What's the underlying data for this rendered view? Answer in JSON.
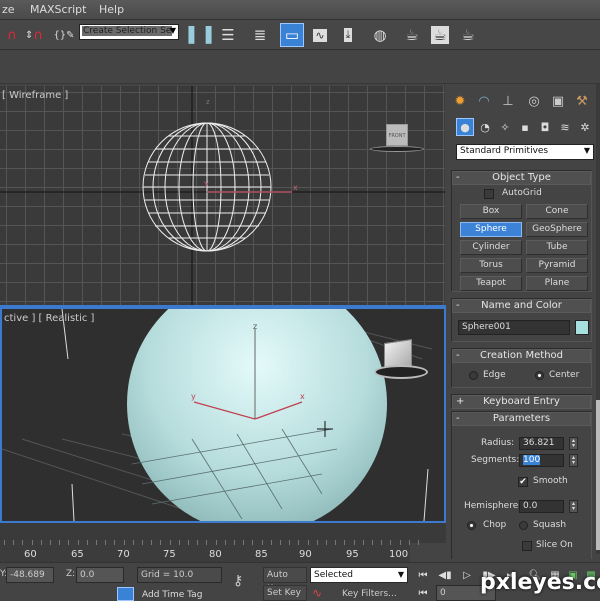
{
  "menubar": {
    "items": [
      "ze",
      "MAXScript",
      "Help"
    ]
  },
  "toolbar": {
    "selection_set": {
      "value": "Create Selection Se",
      "placeholder": "Create Selection Set"
    },
    "icons": [
      "percent-snap-icon",
      "spinner-snap-icon",
      "edit-named-selection-icon",
      "mirror-icon",
      "align-icon",
      "layer-manager-icon",
      "graphite-ribbon-icon",
      "curve-editor-icon",
      "schematic-view-icon",
      "material-editor-icon",
      "render-setup-icon",
      "rendered-frame-icon",
      "render-icon"
    ]
  },
  "viewports": {
    "top": {
      "label": "[ Wireframe ]",
      "axis_x": "x",
      "axis_y": "y",
      "axis_z": "z",
      "viewcube_label": "FRONT"
    },
    "perspective": {
      "label": "ctive ] [ Realistic ]",
      "axis_x": "x",
      "axis_y": "y",
      "axis_z": "z"
    }
  },
  "command_panel": {
    "tabs": [
      "create",
      "modify",
      "hierarchy",
      "motion",
      "display",
      "utilities"
    ],
    "subcategories": [
      "geometry",
      "shapes",
      "lights",
      "cameras",
      "helpers",
      "space-warps",
      "systems"
    ],
    "category_dropdown": "Standard Primitives",
    "object_type": {
      "title": "Object Type",
      "sign": "-",
      "autogrid_label": "AutoGrid",
      "autogrid_checked": false,
      "buttons": [
        "Box",
        "Cone",
        "Sphere",
        "GeoSphere",
        "Cylinder",
        "Tube",
        "Torus",
        "Pyramid",
        "Teapot",
        "Plane"
      ],
      "selected": "Sphere"
    },
    "name_and_color": {
      "title": "Name and Color",
      "sign": "-",
      "name": "Sphere001",
      "color": "#a8e0e0"
    },
    "creation_method": {
      "title": "Creation Method",
      "sign": "-",
      "options": [
        "Edge",
        "Center"
      ],
      "selected": "Center"
    },
    "keyboard_entry": {
      "title": "Keyboard Entry",
      "sign": "+"
    },
    "parameters": {
      "title": "Parameters",
      "sign": "-",
      "radius_label": "Radius:",
      "radius": "36.821",
      "segments_label": "Segments:",
      "segments": "100",
      "smooth_label": "Smooth",
      "smooth_checked": true,
      "hemisphere_label": "Hemisphere:",
      "hemisphere": "0.0",
      "chop_label": "Chop",
      "squash_label": "Squash",
      "hemi_mode": "Chop",
      "slice_label": "Slice On",
      "slice_checked": false
    }
  },
  "timeline": {
    "ticks": [
      "60",
      "65",
      "70",
      "75",
      "80",
      "85",
      "90",
      "95",
      "100"
    ]
  },
  "statusbar": {
    "y_label": "Y:",
    "y_value": "-48.689",
    "z_label": "Z:",
    "z_value": "0.0",
    "grid": "Grid = 10.0",
    "add_time_tag": "Add Time Tag",
    "auto_key": "Auto Key",
    "set_key": "Set Key",
    "key_mode": "Selected",
    "key_filters": "Key Filters...",
    "current_frame": "0"
  },
  "watermark": "pxleyes.com"
}
